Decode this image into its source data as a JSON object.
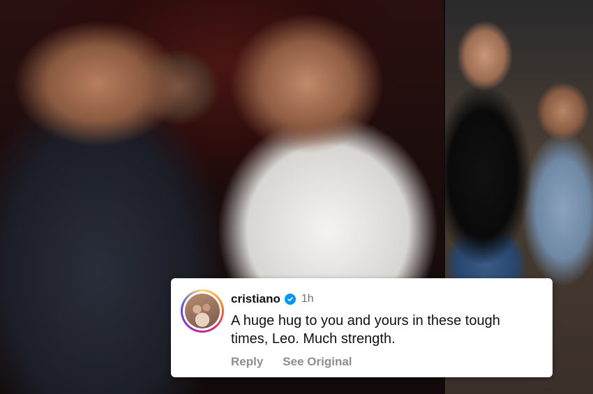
{
  "comment": {
    "username": "cristiano",
    "verified_icon": "verified-badge-icon",
    "time": "1h",
    "text": "A huge hug to you and yours in these tough times, Leo. Much strength.",
    "reply_label": "Reply",
    "see_original_label": "See Original"
  },
  "colors": {
    "verified_blue": "#0095f6",
    "action_gray": "#8e8e8e",
    "time_gray": "#737373"
  }
}
